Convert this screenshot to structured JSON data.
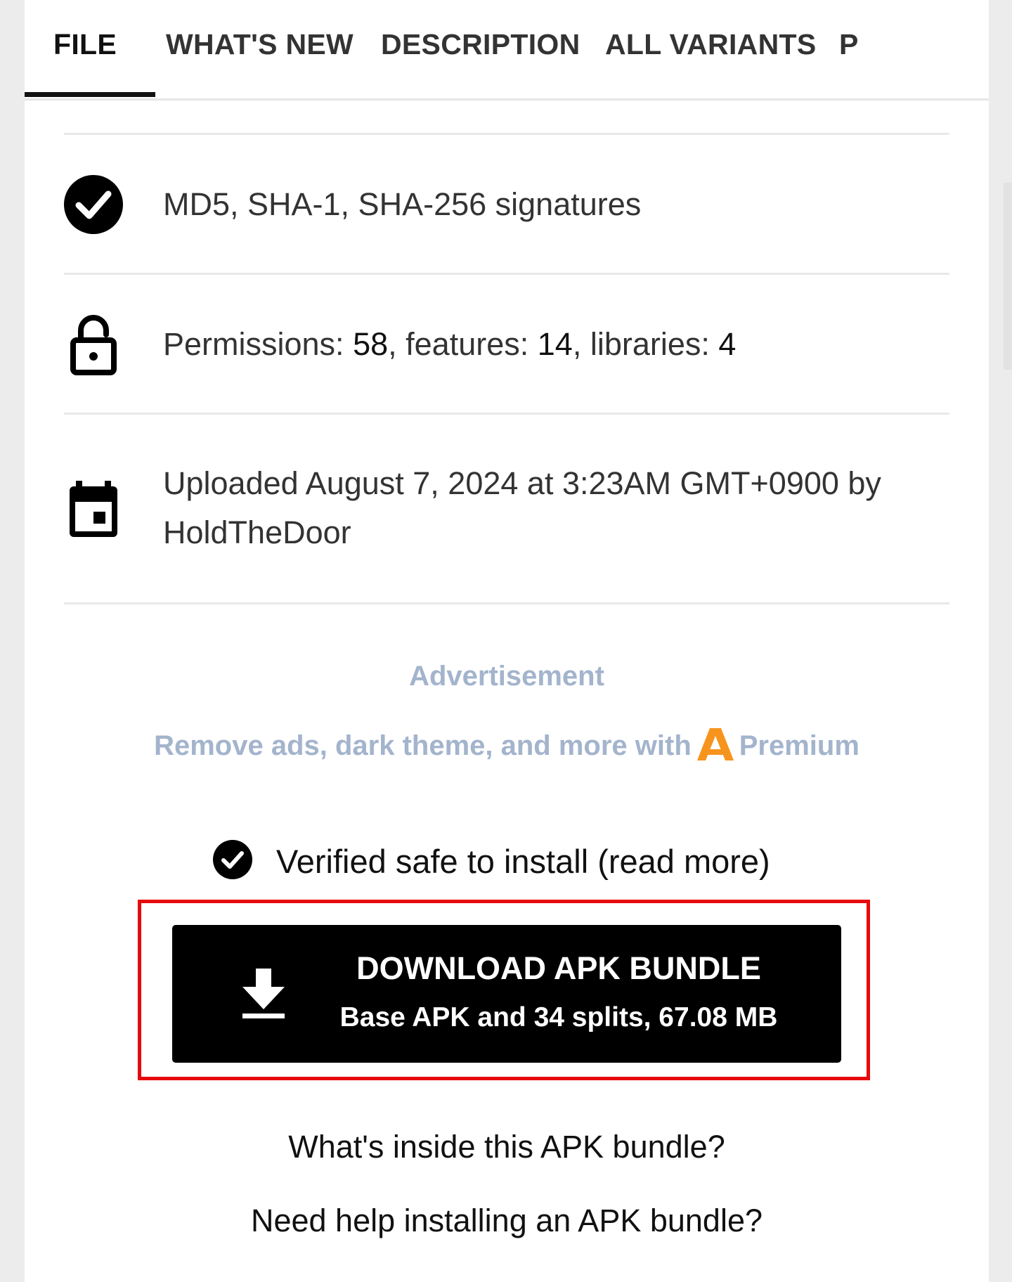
{
  "tabs": [
    {
      "label": "FILE",
      "active": true
    },
    {
      "label": "WHAT'S NEW"
    },
    {
      "label": "DESCRIPTION"
    },
    {
      "label": "ALL VARIANTS"
    },
    {
      "label": "P"
    }
  ],
  "rows": {
    "signatures": {
      "icon": "check-circle-icon",
      "text": "MD5, SHA-1, SHA-256 signatures"
    },
    "permissions": {
      "icon": "lock-open-icon",
      "label_permissions": "Permissions: ",
      "permissions": "58",
      "label_features": ", features: ",
      "features": "14",
      "label_libraries": ", libraries: ",
      "libraries": "4"
    },
    "uploaded": {
      "icon": "calendar-icon",
      "text": "Uploaded August 7, 2024 at 3:23AM GMT+0900 by HoldTheDoor"
    }
  },
  "ad": {
    "label": "Advertisement",
    "premium_prefix": "Remove ads, dark theme, and more with",
    "premium_icon": "apkmirror-logo-icon",
    "premium_label": "Premium"
  },
  "verified": {
    "icon": "check-circle-icon",
    "text": "Verified safe to install (read more)"
  },
  "download": {
    "icon": "download-icon",
    "title": "DOWNLOAD APK BUNDLE",
    "subtitle": "Base APK and 34 splits, 67.08 MB"
  },
  "help": {
    "inside": "What's inside this APK bundle?",
    "installing": "Need help installing an APK bundle?"
  },
  "colors": {
    "accent_ad_text": "#a3b4cc",
    "premium_logo": "#f7941d",
    "highlight": "#e8090d",
    "button_bg": "#000000"
  }
}
